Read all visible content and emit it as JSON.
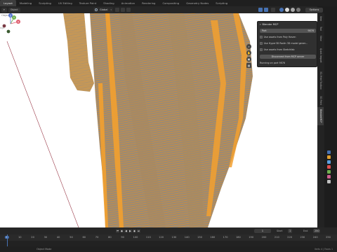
{
  "workspace_tabs": [
    "Layout",
    "Modeling",
    "Sculpting",
    "UV Editing",
    "Texture Paint",
    "Shading",
    "Animation",
    "Rendering",
    "Compositing",
    "Geometry Nodes",
    "Scripting"
  ],
  "workspace_active_index": 0,
  "viewport": {
    "object_label": "Object",
    "side_label": "ngs",
    "transform_orientation": "Global",
    "options_label": "Options",
    "gizmo_axis_x": "X",
    "gizmo_axis_y": "Y",
    "gizmo_axis_z": "Z"
  },
  "mcp_panel": {
    "title": "Blender MCP",
    "port_label": "Port",
    "port_value": "9876",
    "checks": [
      {
        "label": "Use assets from Poly Haven",
        "checked": false
      },
      {
        "label": "Use Hyper3D Rodin 3D model gener...",
        "checked": false
      },
      {
        "label": "Use assets from Sketchfab",
        "checked": false
      }
    ],
    "disconnect_label": "Disconnect from MCP server",
    "status_text": "Running on port 9876"
  },
  "side_tabs": [
    "Item",
    "Tool",
    "View",
    "Quick Import",
    "3D-Print Toolbox",
    "3D Print",
    "BlenderMCP"
  ],
  "side_tab_active": 6,
  "timeline": {
    "current_frame": "1",
    "start_label": "Start",
    "start_value": "1",
    "end_label": "End",
    "end_value": "250",
    "ruler": [
      "0",
      "10",
      "20",
      "30",
      "40",
      "50",
      "60",
      "70",
      "80",
      "90",
      "100",
      "110",
      "120",
      "130",
      "140",
      "150",
      "160",
      "170",
      "180",
      "190",
      "200",
      "210",
      "220",
      "230",
      "240",
      "250"
    ],
    "ruler_current": "0"
  },
  "status_bar": {
    "left": "Object Mode",
    "right": "Verts 4 | Faces 1"
  },
  "colors": {
    "accent": "#4772b3",
    "mesh_orange": "#e8901e",
    "mesh_dark": "#8a6a45"
  }
}
